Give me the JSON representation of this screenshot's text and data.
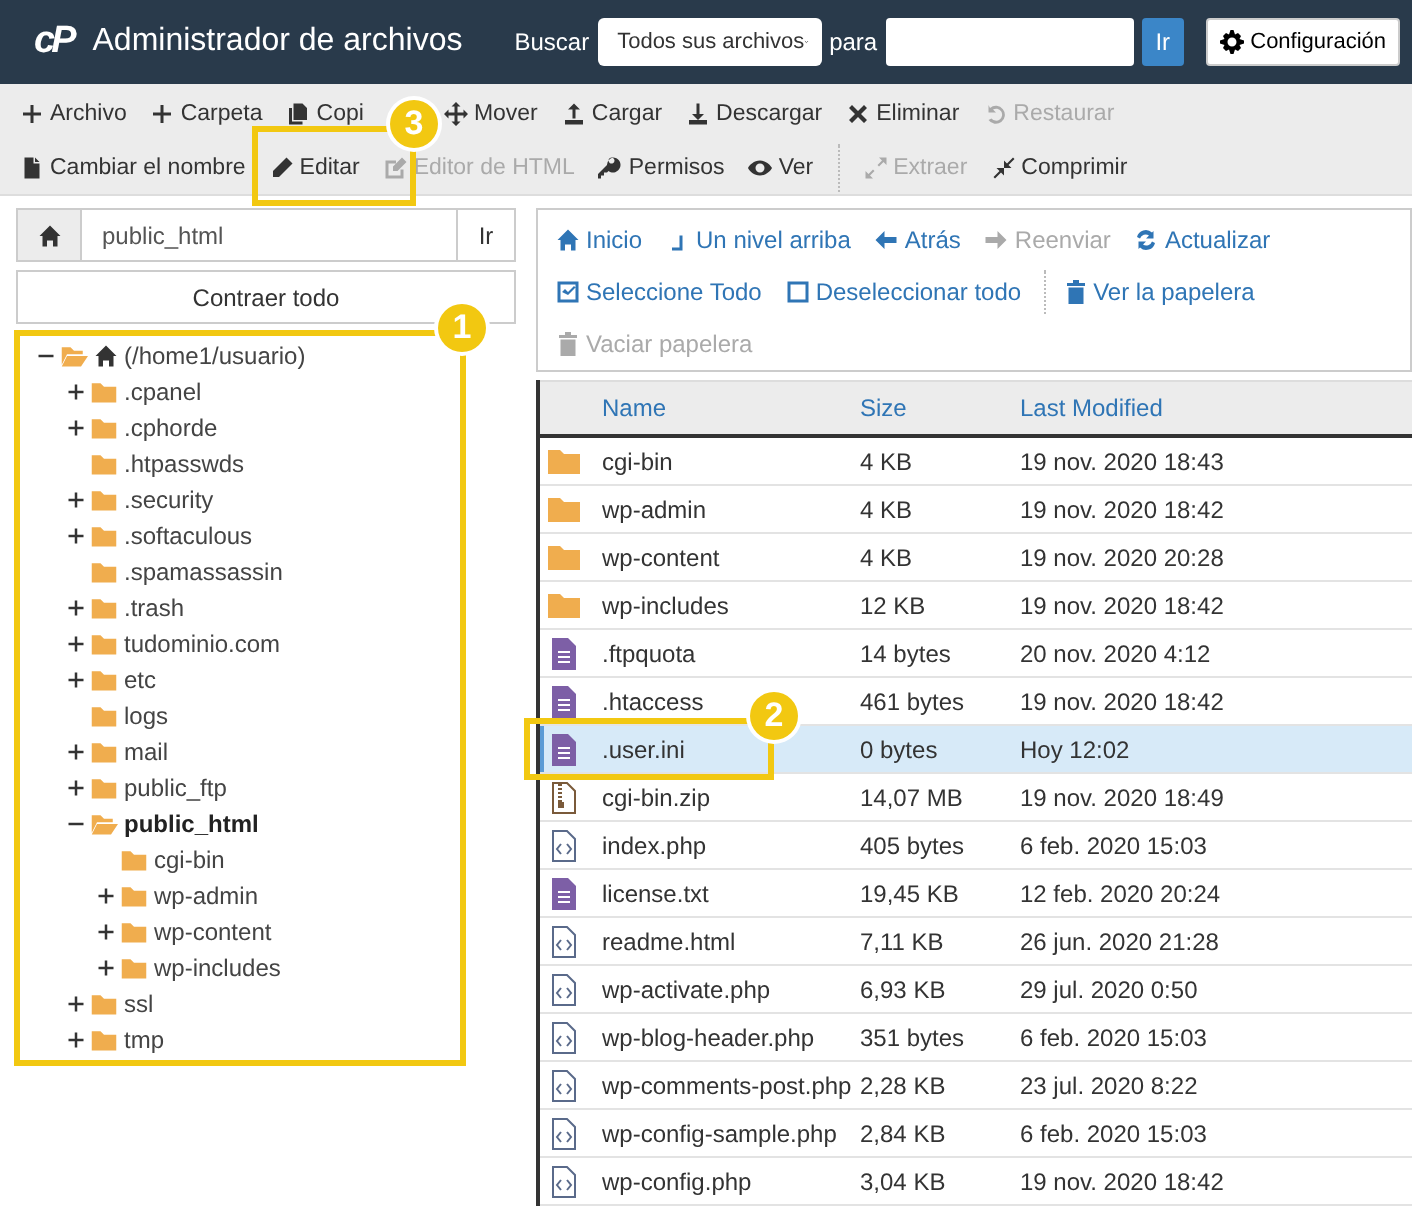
{
  "header": {
    "logo": "cP",
    "title": "Administrador de archivos",
    "search_label": "Buscar",
    "scope": "Todos sus archivos",
    "for_label": "para",
    "go_button": "Ir",
    "settings_button": "Configuración"
  },
  "toolbar": {
    "rows": [
      [
        [
          {
            "label": "Archivo",
            "disabled": false
          },
          {
            "label": "Carpeta",
            "disabled": false
          },
          {
            "label": "Copi",
            "disabled": false
          },
          {
            "label": "Mover",
            "disabled": false
          },
          {
            "label": "Cargar",
            "disabled": false
          },
          {
            "label": "Descargar",
            "disabled": false
          },
          {
            "label": "Eliminar",
            "disabled": false
          },
          {
            "label": "Restaurar",
            "disabled": true
          }
        ]
      ],
      [
        [
          {
            "label": "Cambiar el nombre",
            "disabled": false
          },
          {
            "label": "Editar",
            "disabled": false
          },
          {
            "label": "Editor de HTML",
            "disabled": true
          },
          {
            "label": "Permisos",
            "disabled": false
          },
          {
            "label": "Ver",
            "disabled": false
          }
        ],
        [
          {
            "label": "Extraer",
            "disabled": true
          },
          {
            "label": "Comprimir",
            "disabled": false
          }
        ]
      ]
    ]
  },
  "path_bar": {
    "value": "public_html",
    "go_button": "Ir",
    "collapse_button": "Contraer todo"
  },
  "tree": {
    "root": {
      "label": "(/home1/usuario)",
      "kind": "root",
      "expandable": true,
      "expanded": true,
      "selected": false,
      "children": [
        {
          "label": ".cpanel",
          "kind": "folder",
          "expandable": true,
          "expanded": false,
          "selected": false
        },
        {
          "label": ".cphorde",
          "kind": "folder",
          "expandable": true,
          "expanded": false,
          "selected": false
        },
        {
          "label": ".htpasswds",
          "kind": "folder",
          "expandable": false,
          "expanded": false,
          "selected": false
        },
        {
          "label": ".security",
          "kind": "folder",
          "expandable": true,
          "expanded": false,
          "selected": false
        },
        {
          "label": ".softaculous",
          "kind": "folder",
          "expandable": true,
          "expanded": false,
          "selected": false
        },
        {
          "label": ".spamassassin",
          "kind": "folder",
          "expandable": false,
          "expanded": false,
          "selected": false
        },
        {
          "label": ".trash",
          "kind": "folder",
          "expandable": true,
          "expanded": false,
          "selected": false
        },
        {
          "label": "tudominio.com",
          "kind": "folder",
          "expandable": true,
          "expanded": false,
          "selected": false
        },
        {
          "label": "etc",
          "kind": "folder",
          "expandable": true,
          "expanded": false,
          "selected": false
        },
        {
          "label": "logs",
          "kind": "folder",
          "expandable": false,
          "expanded": false,
          "selected": false
        },
        {
          "label": "mail",
          "kind": "folder",
          "expandable": true,
          "expanded": false,
          "selected": false
        },
        {
          "label": "public_ftp",
          "kind": "folder",
          "expandable": true,
          "expanded": false,
          "selected": false
        },
        {
          "label": "public_html",
          "kind": "folder",
          "expandable": true,
          "expanded": true,
          "selected": true,
          "children": [
            {
              "label": "cgi-bin",
              "kind": "folder",
              "expandable": false,
              "expanded": false,
              "selected": false
            },
            {
              "label": "wp-admin",
              "kind": "folder",
              "expandable": true,
              "expanded": false,
              "selected": false
            },
            {
              "label": "wp-content",
              "kind": "folder",
              "expandable": true,
              "expanded": false,
              "selected": false
            },
            {
              "label": "wp-includes",
              "kind": "folder",
              "expandable": true,
              "expanded": false,
              "selected": false
            }
          ]
        },
        {
          "label": "ssl",
          "kind": "folder",
          "expandable": true,
          "expanded": false,
          "selected": false
        },
        {
          "label": "tmp",
          "kind": "folder",
          "expandable": true,
          "expanded": false,
          "selected": false
        }
      ]
    }
  },
  "nav": {
    "rows": [
      [
        [
          {
            "label": "Inicio",
            "disabled": false
          },
          {
            "label": "Un nivel arriba",
            "disabled": false
          },
          {
            "label": "Atrás",
            "disabled": false
          },
          {
            "label": "Reenviar",
            "disabled": true
          },
          {
            "label": "Actualizar",
            "disabled": false
          }
        ]
      ],
      [
        [
          {
            "label": "Seleccione Todo",
            "disabled": false
          },
          {
            "label": "Deseleccionar todo",
            "disabled": false
          }
        ],
        [
          {
            "label": "Ver la papelera",
            "disabled": false
          }
        ]
      ],
      [
        [
          {
            "label": "Vaciar papelera",
            "disabled": true
          }
        ]
      ]
    ]
  },
  "table": {
    "columns": [
      "Name",
      "Size",
      "Last Modified"
    ],
    "rows": [
      {
        "kind": "folder",
        "name": "cgi-bin",
        "size": "4 KB",
        "modified": "19 nov. 2020 18:43",
        "selected": false
      },
      {
        "kind": "folder",
        "name": "wp-admin",
        "size": "4 KB",
        "modified": "19 nov. 2020 18:42",
        "selected": false
      },
      {
        "kind": "folder",
        "name": "wp-content",
        "size": "4 KB",
        "modified": "19 nov. 2020 20:28",
        "selected": false
      },
      {
        "kind": "folder",
        "name": "wp-includes",
        "size": "12 KB",
        "modified": "19 nov. 2020 18:42",
        "selected": false
      },
      {
        "kind": "text",
        "name": ".ftpquota",
        "size": "14 bytes",
        "modified": "20 nov. 2020 4:12",
        "selected": false
      },
      {
        "kind": "text",
        "name": ".htaccess",
        "size": "461 bytes",
        "modified": "19 nov. 2020 18:42",
        "selected": false
      },
      {
        "kind": "text",
        "name": ".user.ini",
        "size": "0 bytes",
        "modified": "Hoy 12:02",
        "selected": true
      },
      {
        "kind": "zip",
        "name": "cgi-bin.zip",
        "size": "14,07 MB",
        "modified": "19 nov. 2020 18:49",
        "selected": false
      },
      {
        "kind": "code",
        "name": "index.php",
        "size": "405 bytes",
        "modified": "6 feb. 2020 15:03",
        "selected": false
      },
      {
        "kind": "text",
        "name": "license.txt",
        "size": "19,45 KB",
        "modified": "12 feb. 2020 20:24",
        "selected": false
      },
      {
        "kind": "code",
        "name": "readme.html",
        "size": "7,11 KB",
        "modified": "26 jun. 2020 21:28",
        "selected": false
      },
      {
        "kind": "code",
        "name": "wp-activate.php",
        "size": "6,93 KB",
        "modified": "29 jul. 2020 0:50",
        "selected": false
      },
      {
        "kind": "code",
        "name": "wp-blog-header.php",
        "size": "351 bytes",
        "modified": "6 feb. 2020 15:03",
        "selected": false
      },
      {
        "kind": "code",
        "name": "wp-comments-post.php",
        "size": "2,28 KB",
        "modified": "23 jul. 2020 8:22",
        "selected": false
      },
      {
        "kind": "code",
        "name": "wp-config-sample.php",
        "size": "2,84 KB",
        "modified": "6 feb. 2020 15:03",
        "selected": false
      },
      {
        "kind": "code",
        "name": "wp-config.php",
        "size": "3,04 KB",
        "modified": "19 nov. 2020 18:42",
        "selected": false
      }
    ]
  },
  "callouts": [
    {
      "number": "1"
    },
    {
      "number": "2"
    },
    {
      "number": "3"
    }
  ]
}
